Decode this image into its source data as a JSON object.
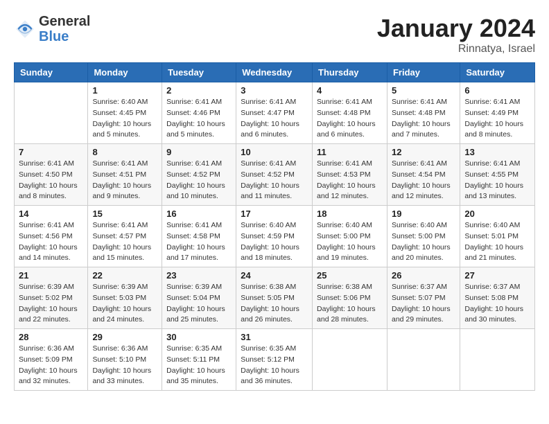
{
  "header": {
    "logo_general": "General",
    "logo_blue": "Blue",
    "month_title": "January 2024",
    "location": "Rinnatya, Israel"
  },
  "weekdays": [
    "Sunday",
    "Monday",
    "Tuesday",
    "Wednesday",
    "Thursday",
    "Friday",
    "Saturday"
  ],
  "weeks": [
    [
      {
        "day": "",
        "sunrise": "",
        "sunset": "",
        "daylight": ""
      },
      {
        "day": "1",
        "sunrise": "Sunrise: 6:40 AM",
        "sunset": "Sunset: 4:45 PM",
        "daylight": "Daylight: 10 hours and 5 minutes."
      },
      {
        "day": "2",
        "sunrise": "Sunrise: 6:41 AM",
        "sunset": "Sunset: 4:46 PM",
        "daylight": "Daylight: 10 hours and 5 minutes."
      },
      {
        "day": "3",
        "sunrise": "Sunrise: 6:41 AM",
        "sunset": "Sunset: 4:47 PM",
        "daylight": "Daylight: 10 hours and 6 minutes."
      },
      {
        "day": "4",
        "sunrise": "Sunrise: 6:41 AM",
        "sunset": "Sunset: 4:48 PM",
        "daylight": "Daylight: 10 hours and 6 minutes."
      },
      {
        "day": "5",
        "sunrise": "Sunrise: 6:41 AM",
        "sunset": "Sunset: 4:48 PM",
        "daylight": "Daylight: 10 hours and 7 minutes."
      },
      {
        "day": "6",
        "sunrise": "Sunrise: 6:41 AM",
        "sunset": "Sunset: 4:49 PM",
        "daylight": "Daylight: 10 hours and 8 minutes."
      }
    ],
    [
      {
        "day": "7",
        "sunrise": "Sunrise: 6:41 AM",
        "sunset": "Sunset: 4:50 PM",
        "daylight": "Daylight: 10 hours and 8 minutes."
      },
      {
        "day": "8",
        "sunrise": "Sunrise: 6:41 AM",
        "sunset": "Sunset: 4:51 PM",
        "daylight": "Daylight: 10 hours and 9 minutes."
      },
      {
        "day": "9",
        "sunrise": "Sunrise: 6:41 AM",
        "sunset": "Sunset: 4:52 PM",
        "daylight": "Daylight: 10 hours and 10 minutes."
      },
      {
        "day": "10",
        "sunrise": "Sunrise: 6:41 AM",
        "sunset": "Sunset: 4:52 PM",
        "daylight": "Daylight: 10 hours and 11 minutes."
      },
      {
        "day": "11",
        "sunrise": "Sunrise: 6:41 AM",
        "sunset": "Sunset: 4:53 PM",
        "daylight": "Daylight: 10 hours and 12 minutes."
      },
      {
        "day": "12",
        "sunrise": "Sunrise: 6:41 AM",
        "sunset": "Sunset: 4:54 PM",
        "daylight": "Daylight: 10 hours and 12 minutes."
      },
      {
        "day": "13",
        "sunrise": "Sunrise: 6:41 AM",
        "sunset": "Sunset: 4:55 PM",
        "daylight": "Daylight: 10 hours and 13 minutes."
      }
    ],
    [
      {
        "day": "14",
        "sunrise": "Sunrise: 6:41 AM",
        "sunset": "Sunset: 4:56 PM",
        "daylight": "Daylight: 10 hours and 14 minutes."
      },
      {
        "day": "15",
        "sunrise": "Sunrise: 6:41 AM",
        "sunset": "Sunset: 4:57 PM",
        "daylight": "Daylight: 10 hours and 15 minutes."
      },
      {
        "day": "16",
        "sunrise": "Sunrise: 6:41 AM",
        "sunset": "Sunset: 4:58 PM",
        "daylight": "Daylight: 10 hours and 17 minutes."
      },
      {
        "day": "17",
        "sunrise": "Sunrise: 6:40 AM",
        "sunset": "Sunset: 4:59 PM",
        "daylight": "Daylight: 10 hours and 18 minutes."
      },
      {
        "day": "18",
        "sunrise": "Sunrise: 6:40 AM",
        "sunset": "Sunset: 5:00 PM",
        "daylight": "Daylight: 10 hours and 19 minutes."
      },
      {
        "day": "19",
        "sunrise": "Sunrise: 6:40 AM",
        "sunset": "Sunset: 5:00 PM",
        "daylight": "Daylight: 10 hours and 20 minutes."
      },
      {
        "day": "20",
        "sunrise": "Sunrise: 6:40 AM",
        "sunset": "Sunset: 5:01 PM",
        "daylight": "Daylight: 10 hours and 21 minutes."
      }
    ],
    [
      {
        "day": "21",
        "sunrise": "Sunrise: 6:39 AM",
        "sunset": "Sunset: 5:02 PM",
        "daylight": "Daylight: 10 hours and 22 minutes."
      },
      {
        "day": "22",
        "sunrise": "Sunrise: 6:39 AM",
        "sunset": "Sunset: 5:03 PM",
        "daylight": "Daylight: 10 hours and 24 minutes."
      },
      {
        "day": "23",
        "sunrise": "Sunrise: 6:39 AM",
        "sunset": "Sunset: 5:04 PM",
        "daylight": "Daylight: 10 hours and 25 minutes."
      },
      {
        "day": "24",
        "sunrise": "Sunrise: 6:38 AM",
        "sunset": "Sunset: 5:05 PM",
        "daylight": "Daylight: 10 hours and 26 minutes."
      },
      {
        "day": "25",
        "sunrise": "Sunrise: 6:38 AM",
        "sunset": "Sunset: 5:06 PM",
        "daylight": "Daylight: 10 hours and 28 minutes."
      },
      {
        "day": "26",
        "sunrise": "Sunrise: 6:37 AM",
        "sunset": "Sunset: 5:07 PM",
        "daylight": "Daylight: 10 hours and 29 minutes."
      },
      {
        "day": "27",
        "sunrise": "Sunrise: 6:37 AM",
        "sunset": "Sunset: 5:08 PM",
        "daylight": "Daylight: 10 hours and 30 minutes."
      }
    ],
    [
      {
        "day": "28",
        "sunrise": "Sunrise: 6:36 AM",
        "sunset": "Sunset: 5:09 PM",
        "daylight": "Daylight: 10 hours and 32 minutes."
      },
      {
        "day": "29",
        "sunrise": "Sunrise: 6:36 AM",
        "sunset": "Sunset: 5:10 PM",
        "daylight": "Daylight: 10 hours and 33 minutes."
      },
      {
        "day": "30",
        "sunrise": "Sunrise: 6:35 AM",
        "sunset": "Sunset: 5:11 PM",
        "daylight": "Daylight: 10 hours and 35 minutes."
      },
      {
        "day": "31",
        "sunrise": "Sunrise: 6:35 AM",
        "sunset": "Sunset: 5:12 PM",
        "daylight": "Daylight: 10 hours and 36 minutes."
      },
      {
        "day": "",
        "sunrise": "",
        "sunset": "",
        "daylight": ""
      },
      {
        "day": "",
        "sunrise": "",
        "sunset": "",
        "daylight": ""
      },
      {
        "day": "",
        "sunrise": "",
        "sunset": "",
        "daylight": ""
      }
    ]
  ]
}
